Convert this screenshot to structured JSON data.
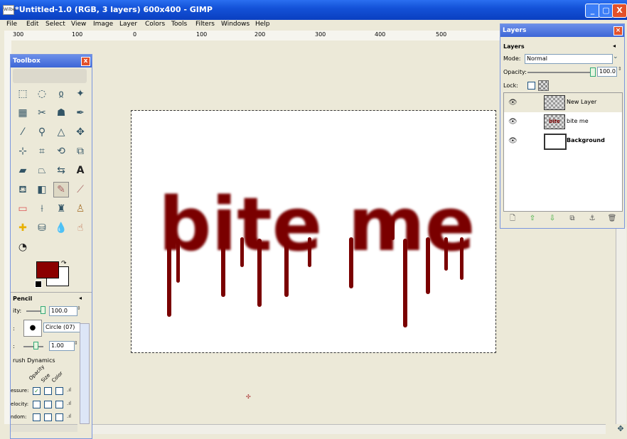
{
  "window": {
    "title": "*Untitled-1.0 (RGB, 3 layers) 600x400 - GIMP",
    "app_icon": "Wilber",
    "minimize": "_",
    "maximize": "▢",
    "close": "X"
  },
  "menubar": [
    "File",
    "Edit",
    "Select",
    "View",
    "Image",
    "Layer",
    "Colors",
    "Tools",
    "Filters",
    "Windows",
    "Help"
  ],
  "ruler": {
    "labels": [
      "300",
      "100",
      "0",
      "100",
      "200",
      "300",
      "400",
      "500"
    ]
  },
  "canvas": {
    "text": "bite me",
    "text_color": "#7a0000"
  },
  "toolbox": {
    "title": "Toolbox",
    "close": "x",
    "tool_icons": [
      "rect-select-icon",
      "ellipse-select-icon",
      "lasso-icon",
      "fuzzy-select-icon",
      "color-select-icon",
      "scissors-icon",
      "foreground-select-icon",
      "paths-icon",
      "color-picker-icon",
      "zoom-icon",
      "measure-icon",
      "move-icon",
      "align-icon",
      "crop-icon",
      "rotate-icon",
      "scale-icon",
      "shear-icon",
      "perspective-icon",
      "flip-icon",
      "text-icon",
      "bucket-fill-icon",
      "gradient-icon",
      "pencil-icon",
      "paintbrush-icon",
      "eraser-icon",
      "airbrush-icon",
      "ink-icon",
      "clone-icon",
      "heal-icon",
      "perspective-clone-icon",
      "blur-icon",
      "smudge-icon",
      "dodge-icon"
    ],
    "fg_color": "#8b0000",
    "bg_color": "#ffffff",
    "options": {
      "title": "Pencil",
      "opacity_label": "ity:",
      "opacity_value": "100.0",
      "brush_label": ":",
      "brush_name": "Circle (07)",
      "scale_label": ":",
      "scale_value": "1.00",
      "dynamics_label": "rush Dynamics",
      "dyn_cols": [
        "Opacity",
        "Size",
        "Color"
      ],
      "dyn_rows": [
        "essure:",
        "elocity:",
        "ndom:"
      ],
      "pressure_opacity_checked": "✓"
    }
  },
  "layers": {
    "title": "Layers",
    "header": "Layers",
    "mode_label": "Mode:",
    "mode_value": "Normal",
    "opacity_label": "Opacity:",
    "opacity_value": "100.0",
    "lock_label": "Lock:",
    "items": [
      {
        "name": "New Layer",
        "bold": false
      },
      {
        "name": "bite me",
        "bold": false
      },
      {
        "name": "Background",
        "bold": true
      }
    ]
  }
}
